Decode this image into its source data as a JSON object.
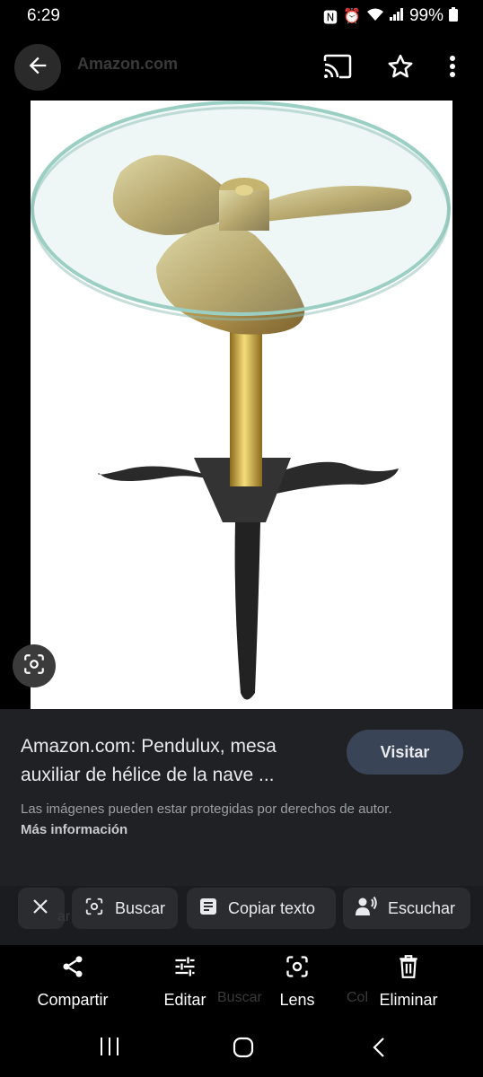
{
  "status": {
    "time": "6:29",
    "battery": "99%"
  },
  "header": {
    "site_title": "Amazon.com"
  },
  "info": {
    "title": "Amazon.com: Pendulux, mesa auxiliar de hélice de la nave ...",
    "visit_label": "Visitar",
    "copyright_text": "Las imágenes pueden estar protegidas por derechos de autor.",
    "more_info_label": "Más información"
  },
  "chips": {
    "search_label": "Buscar",
    "copy_text_label": "Copiar texto",
    "listen_label": "Escuchar",
    "ghost_text": "ar"
  },
  "actions": {
    "share_label": "Compartir",
    "edit_label": "Editar",
    "lens_label": "Lens",
    "delete_label": "Eliminar",
    "ghost_search": "Buscar",
    "ghost_collect": "Col"
  }
}
